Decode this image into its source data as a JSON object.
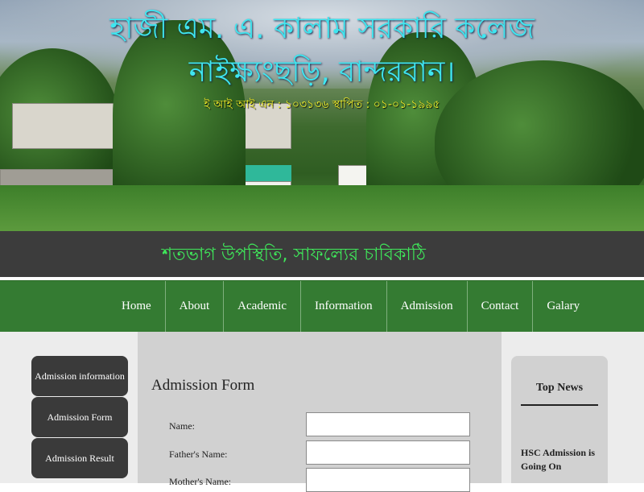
{
  "header": {
    "title_line1": "হাজী এম. এ. কালাম সরকারি কলেজ",
    "title_line2": "নাইক্ষ্যংছড়ি, বান্দরবান।",
    "eiin": "ই আই আই এন : ১০৩১৩৬ স্থাপিত : ০১-০১-১৯৯৫",
    "motto": "শতভাগ উপস্থিতি, সাফল্যের চাবিকাঠি"
  },
  "nav": {
    "items": [
      "Home",
      "About",
      "Academic",
      "Information",
      "Admission",
      "Contact",
      "Galary"
    ]
  },
  "sidebar": {
    "items": [
      "Admission information",
      "Admission Form",
      "Admission Result"
    ]
  },
  "form": {
    "title": "Admission Form",
    "fields": [
      {
        "label": "Name:",
        "value": ""
      },
      {
        "label": "Father's Name:",
        "value": ""
      },
      {
        "label": "Mother's Name:",
        "value": ""
      }
    ]
  },
  "news": {
    "title": "Top News",
    "items": [
      "HSC Admission is Going On"
    ]
  }
}
